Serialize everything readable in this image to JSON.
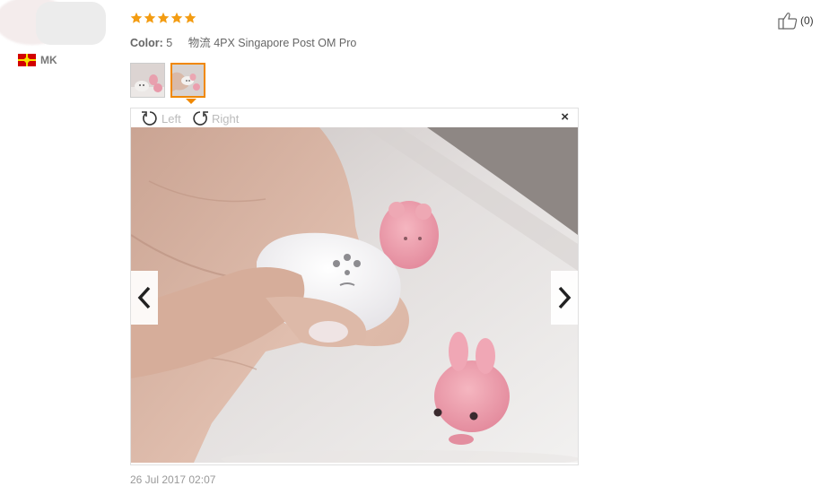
{
  "review": {
    "country_code": "MK",
    "rating": 5,
    "color_label": "Color:",
    "color_value": "5",
    "shipping": "物流 4PX Singapore Post OM Pro",
    "helpful_count": "(0)",
    "date": "26 Jul 2017 02:07"
  },
  "viewer": {
    "rotate_left_label": "Left",
    "rotate_right_label": "Right",
    "close_label": "×"
  },
  "icons": {
    "star": "star-icon",
    "thumbs_up": "thumbs-up-icon",
    "rotate_left": "rotate-left-icon",
    "rotate_right": "rotate-right-icon",
    "prev": "chevron-left-icon",
    "next": "chevron-right-icon",
    "close": "close-icon",
    "flag": "flag-icon"
  },
  "colors": {
    "star": "#f39c12",
    "thumb_active_border": "#f08800"
  }
}
